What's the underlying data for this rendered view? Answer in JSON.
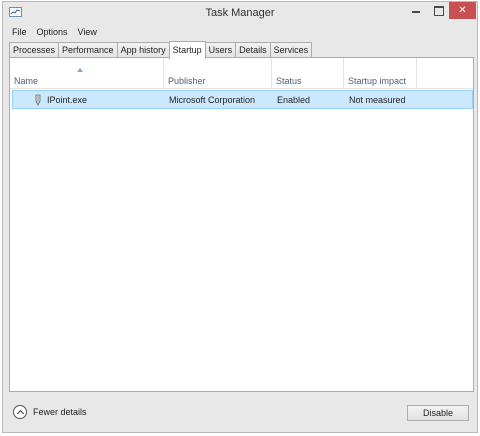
{
  "window": {
    "title": "Task Manager",
    "close_glyph": "✕"
  },
  "menu": [
    "File",
    "Options",
    "View"
  ],
  "tabs": [
    "Processes",
    "Performance",
    "App history",
    "Startup",
    "Users",
    "Details",
    "Services"
  ],
  "active_tab": "Startup",
  "columns": [
    "Name",
    "Publisher",
    "Status",
    "Startup impact"
  ],
  "rows": [
    {
      "icon": "pen-icon",
      "name": "IPoint.exe",
      "publisher": "Microsoft Corporation",
      "status": "Enabled",
      "impact": "Not measured"
    }
  ],
  "footer": {
    "fewer_details": "Fewer details",
    "disable_button": "Disable"
  },
  "colors": {
    "selected_row": "#cce8ff",
    "close_button": "#c75050"
  }
}
